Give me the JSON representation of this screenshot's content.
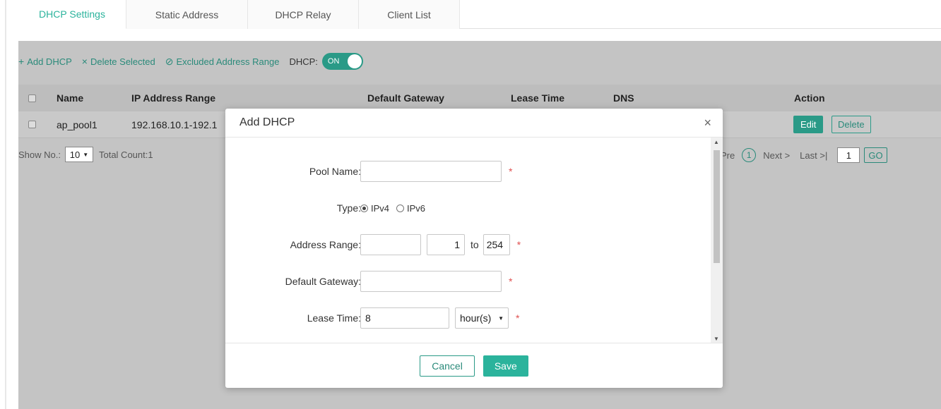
{
  "tabs": [
    {
      "label": "DHCP Settings"
    },
    {
      "label": "Static Address"
    },
    {
      "label": "DHCP Relay"
    },
    {
      "label": "Client List"
    }
  ],
  "toolbar": {
    "add_label": "Add DHCP",
    "delete_label": "Delete Selected",
    "excluded_label": "Excluded Address Range",
    "dhcp_label": "DHCP:",
    "dhcp_toggle": "ON"
  },
  "table": {
    "headers": [
      "Name",
      "IP Address Range",
      "Default Gateway",
      "Lease Time",
      "DNS",
      "Action"
    ],
    "rows": [
      {
        "name": "ap_pool1",
        "ip_range": "192.168.10.1-192.1",
        "edit": "Edit",
        "delete": "Delete"
      }
    ]
  },
  "pager": {
    "show_no_label": "Show No.:",
    "page_size": "10",
    "total_label": "Total Count:1",
    "pre_label": "Pre",
    "current_page": "1",
    "next_label": "Next >",
    "last_label": "Last >|",
    "page_input": "1",
    "go_label": "GO"
  },
  "modal": {
    "title": "Add DHCP",
    "close": "×",
    "fields": {
      "pool_name_label": "Pool Name:",
      "pool_name_value": "",
      "type_label": "Type:",
      "type_ipv4": "IPv4",
      "type_ipv6": "IPv6",
      "address_range_label": "Address Range:",
      "address_prefix": "",
      "address_start": "1",
      "address_to": "to",
      "address_end": "254",
      "gateway_label": "Default Gateway:",
      "gateway_value": "",
      "lease_label": "Lease Time:",
      "lease_value": "8",
      "lease_unit": "hour(s)",
      "required_mark": "*"
    },
    "cancel_label": "Cancel",
    "save_label": "Save"
  },
  "colors": {
    "accent": "#2bb39c",
    "accent_dark": "#2a9a87",
    "required": "#e05050"
  }
}
